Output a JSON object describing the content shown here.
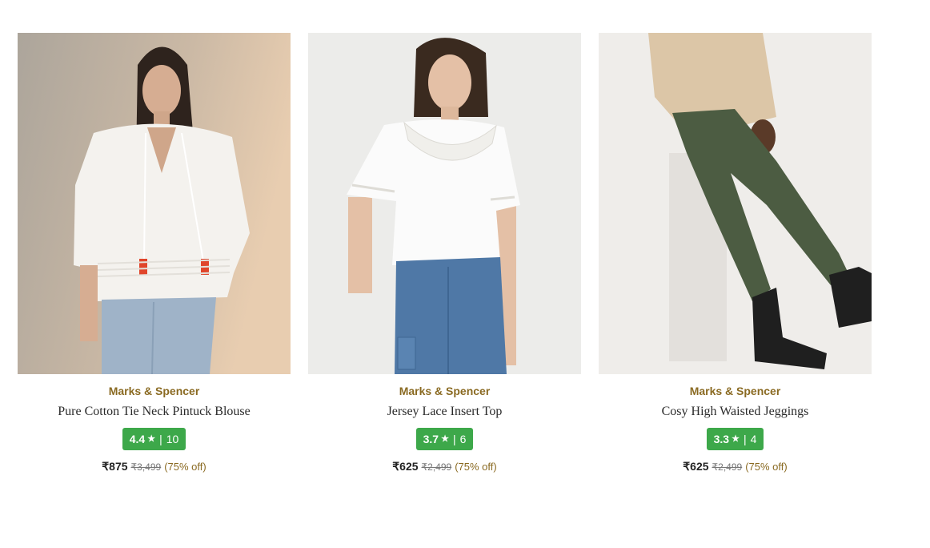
{
  "products": [
    {
      "image_alt": "woman-in-white-blouse",
      "brand": "Marks & Spencer",
      "title": "Pure Cotton Tie Neck Pintuck Blouse",
      "rating": "4.4",
      "rating_count": "10",
      "price": "₹875",
      "mrp": "₹3,499",
      "discount": "(75% off)"
    },
    {
      "image_alt": "woman-in-white-lace-top",
      "brand": "Marks & Spencer",
      "title": "Jersey Lace Insert Top",
      "rating": "3.7",
      "rating_count": "6",
      "price": "₹625",
      "mrp": "₹2,499",
      "discount": "(75% off)"
    },
    {
      "image_alt": "green-jeggings-with-boots",
      "brand": "Marks & Spencer",
      "title": "Cosy High Waisted Jeggings",
      "rating": "3.3",
      "rating_count": "4",
      "price": "₹625",
      "mrp": "₹2,499",
      "discount": "(75% off)"
    }
  ],
  "labels": {
    "star": "★",
    "separator": "|"
  },
  "colors": {
    "brand_text": "#8a6a22",
    "rating_badge": "#3da84a"
  }
}
